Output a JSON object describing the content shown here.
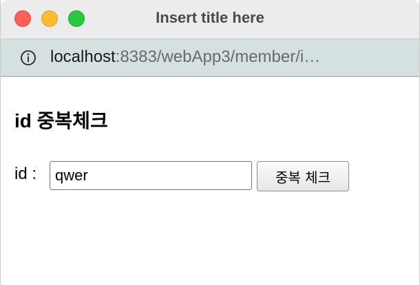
{
  "window": {
    "title": "Insert title here"
  },
  "urlbar": {
    "host": "localhost",
    "rest": ":8383/webApp3/member/i…"
  },
  "page": {
    "heading": "id 중복체크",
    "id_label": "id :",
    "id_value": "qwer",
    "check_button_label": "중복 체크"
  },
  "icons": {
    "info": "info-icon"
  },
  "colors": {
    "close": "#fe5f57",
    "minimize": "#febc2e",
    "maximize": "#28c840",
    "urlbar_bg": "#d5e0e0"
  }
}
